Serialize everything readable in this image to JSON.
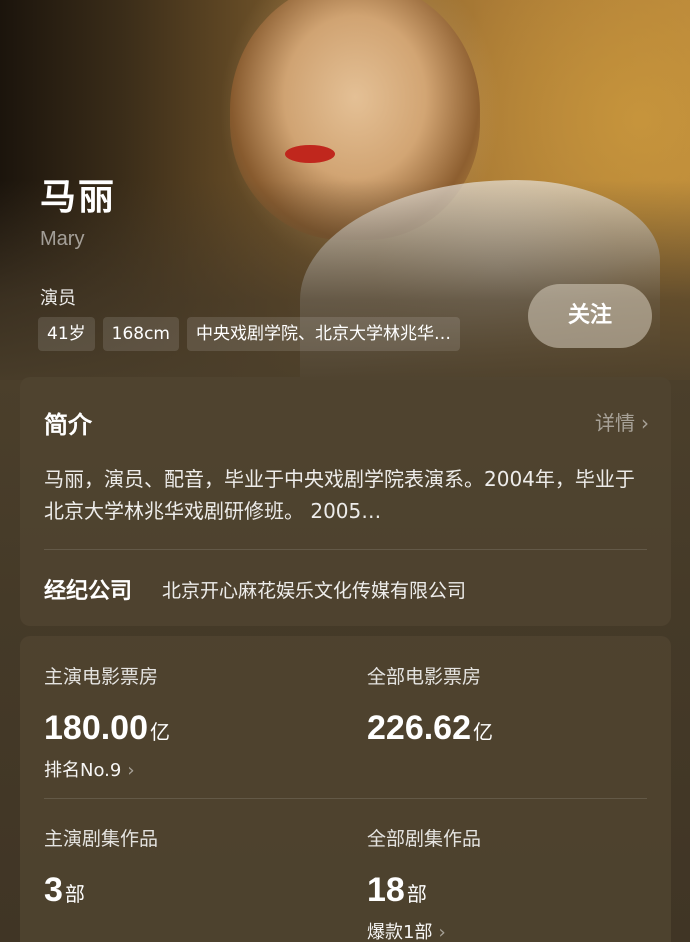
{
  "profile": {
    "name": "马丽",
    "name_en": "Mary",
    "role": "演员",
    "tags": [
      "41岁",
      "168cm",
      "中央戏剧学院、北京大学林兆华…"
    ],
    "follow_label": "关注"
  },
  "intro": {
    "title": "简介",
    "more_label": "详情",
    "text": "马丽，演员、配音，毕业于中央戏剧学院表演系。2004年，毕业于北京大学林兆华戏剧研修班。 2005…",
    "agency_label": "经纪公司",
    "agency_value": "北京开心麻花娱乐文化传媒有限公司"
  },
  "stats": {
    "lead_movie_box": {
      "label": "主演电影票房",
      "value": "180.00",
      "unit": "亿",
      "sub": "排名No.9"
    },
    "all_movie_box": {
      "label": "全部电影票房",
      "value": "226.62",
      "unit": "亿"
    },
    "lead_series": {
      "label": "主演剧集作品",
      "value": "3",
      "unit": "部"
    },
    "all_series": {
      "label": "全部剧集作品",
      "value": "18",
      "unit": "部",
      "sub": "爆款1部"
    }
  },
  "icons": {
    "chevron": "chevron-right-icon"
  },
  "colors": {
    "background": "#4a3d2a",
    "card": "#50442f",
    "text": "#ffffff"
  }
}
